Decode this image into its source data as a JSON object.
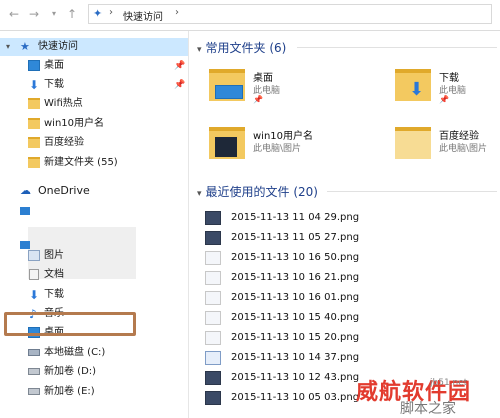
{
  "toolbar": {
    "address_path": "快速访问",
    "back_icon": "arrow-left-icon",
    "forward_icon": "arrow-right-icon",
    "recent_icon": "chevron-down-icon",
    "up_icon": "arrow-up-icon"
  },
  "sidebar": {
    "quick_access": "快速访问",
    "quick_items": [
      {
        "label": "桌面",
        "icon": "desktop-icon",
        "pinned": true
      },
      {
        "label": "下载",
        "icon": "download-icon",
        "pinned": true
      },
      {
        "label": "Wifi热点",
        "icon": "folder-icon"
      },
      {
        "label": "win10用户名",
        "icon": "folder-icon"
      },
      {
        "label": "百度经验",
        "icon": "folder-icon"
      },
      {
        "label": "新建文件夹 (55)",
        "icon": "folder-icon"
      }
    ],
    "onedrive": "OneDrive",
    "pc_items": [
      {
        "label": "图片",
        "icon": "pictures-icon"
      },
      {
        "label": "文档",
        "icon": "documents-icon"
      },
      {
        "label": "下载",
        "icon": "download-icon",
        "highlighted": true
      },
      {
        "label": "音乐",
        "icon": "music-icon"
      },
      {
        "label": "桌面",
        "icon": "desktop-icon"
      },
      {
        "label": "本地磁盘 (C:)",
        "icon": "drive-icon"
      },
      {
        "label": "新加卷 (D:)",
        "icon": "drive-icon"
      },
      {
        "label": "新加卷 (E:)",
        "icon": "drive-icon"
      }
    ]
  },
  "main": {
    "frequent_header": "常用文件夹 (6)",
    "frequent": [
      {
        "name": "桌面",
        "sub": "此电脑",
        "icon": "desktop-folder-icon"
      },
      {
        "name": "下载",
        "sub": "此电脑",
        "icon": "download-folder-icon"
      },
      {
        "name": "win10用户名",
        "sub": "此电脑\\图片",
        "icon": "folder-icon"
      },
      {
        "name": "百度经验",
        "sub": "此电脑\\图片",
        "icon": "folder-icon"
      }
    ],
    "recent_header": "最近使用的文件 (20)",
    "recent": [
      "2015-11-13 11 04 29.png",
      "2015-11-13 11 05 27.png",
      "2015-11-13 10 16 50.png",
      "2015-11-13 10 16 21.png",
      "2015-11-13 10 16 01.png",
      "2015-11-13 10 15 40.png",
      "2015-11-13 10 15 20.png",
      "2015-11-13 10 14 37.png",
      "2015-11-13 10 12 43.png",
      "2015-11-13 10 05 03.png"
    ]
  },
  "watermark": {
    "brand": "威航软件园",
    "site": "jb51.net",
    "sub": "脚本之家"
  },
  "colors": {
    "accent": "#1e3f8a",
    "highlight_box": "#b47a4e",
    "folder": "#f3c960",
    "watermark": "#e23b2e"
  }
}
